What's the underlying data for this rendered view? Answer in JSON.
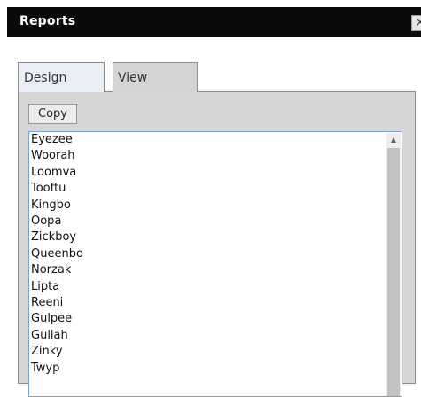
{
  "window": {
    "title": "Reports",
    "close_glyph": "×",
    "icon_names": [
      "close-icon",
      "scroll-up-arrow-icon"
    ]
  },
  "tabs": [
    {
      "label": "Design",
      "active": true
    },
    {
      "label": "View",
      "active": false
    }
  ],
  "toolbar": {
    "copy_label": "Copy"
  },
  "list": {
    "items": [
      "Eyezee",
      "Woorah",
      "Loomva",
      "Tooftu",
      "Kingbo",
      "Oopa",
      "Zickboy",
      "Queenbo",
      "Norzak",
      "Lipta",
      "Reeni",
      "Gulpee",
      "Gullah",
      "Zinky",
      "Twyp"
    ],
    "scroll_up_glyph": "▲"
  },
  "colors": {
    "titlebar": "#0b0b0b",
    "panel": "#d6d6d6",
    "active_tab": "#e9eef4",
    "list_border": "#7f9ed3"
  }
}
